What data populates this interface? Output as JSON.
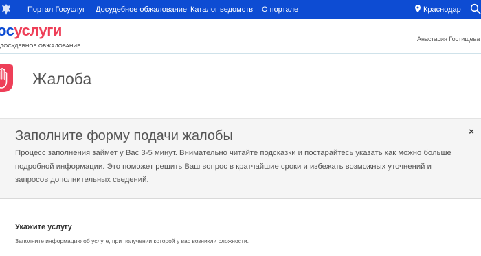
{
  "topnav": {
    "links": [
      "Портал Госуслуг",
      "Досудебное обжалование",
      "Каталог ведомств",
      "О портале"
    ],
    "city": "Краснодар",
    "bg_color": "#0d4cd3"
  },
  "header": {
    "logo_part1": "ос",
    "logo_part2": "услуги",
    "logo_sub": "досудебное обжалование",
    "user_name": "Анастасия Гостищева"
  },
  "page": {
    "title": "Жалоба",
    "icon": "hand-stop-icon",
    "accent_color": "#ee3f58"
  },
  "notice": {
    "title": "Заполните форму подачи жалобы",
    "text": "Процесс заполнения займет у Вас 3-5 минут. Внимательно читайте подсказки и постарайтесь указать как можно больше подробной информации. Это поможет решить Ваш вопрос в кратчайшие сроки и избежать возможных уточнений и запросов дополнительных сведений.",
    "close_symbol": "×"
  },
  "section": {
    "title": "Укажите услугу",
    "description": "Заполните информацию об услуге, при получении которой у вас возникли сложности."
  }
}
